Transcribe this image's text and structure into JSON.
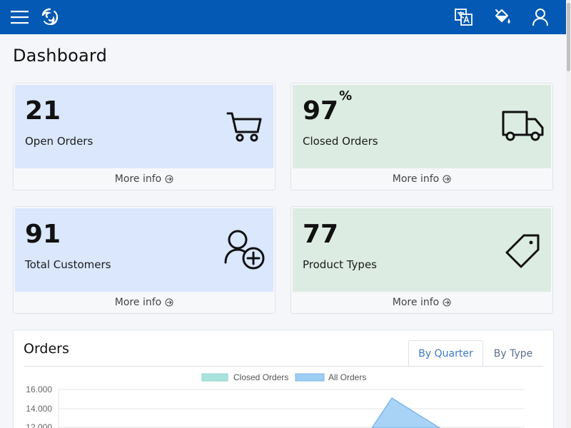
{
  "colors": {
    "topbar": "#0359b4",
    "card_blue": "#dae7fd",
    "card_green": "#dcece3",
    "tab_active": "#3d79c7",
    "closed_orders_series": "#a8e3de",
    "all_orders_series": "#9fcdf4"
  },
  "header": {
    "icons": [
      "menu-icon",
      "logo-icon",
      "translate-icon",
      "paint-bucket-icon",
      "user-icon"
    ]
  },
  "page": {
    "title": "Dashboard"
  },
  "cards": [
    {
      "value": "21",
      "unit": "",
      "label": "Open Orders",
      "footer": "More info",
      "icon": "cart-icon"
    },
    {
      "value": "97",
      "unit": "%",
      "label": "Closed Orders",
      "footer": "More info",
      "icon": "truck-icon"
    },
    {
      "value": "91",
      "unit": "",
      "label": "Total Customers",
      "footer": "More info",
      "icon": "add-user-icon"
    },
    {
      "value": "77",
      "unit": "",
      "label": "Product Types",
      "footer": "More info",
      "icon": "tag-icon"
    }
  ],
  "orders": {
    "title": "Orders",
    "tabs": [
      {
        "label": "By Quarter",
        "active": true
      },
      {
        "label": "By Type",
        "active": false
      }
    ]
  },
  "chart_data": {
    "type": "area",
    "series": [
      {
        "name": "Closed Orders",
        "color": "#a8e3de"
      },
      {
        "name": "All Orders",
        "color": "#9fcdf4",
        "peak": 15000
      }
    ],
    "y_ticks": [
      "16.000",
      "14.000",
      "12.000"
    ],
    "ylim": [
      12000,
      16000
    ],
    "grid": true,
    "legend": "top-center"
  }
}
